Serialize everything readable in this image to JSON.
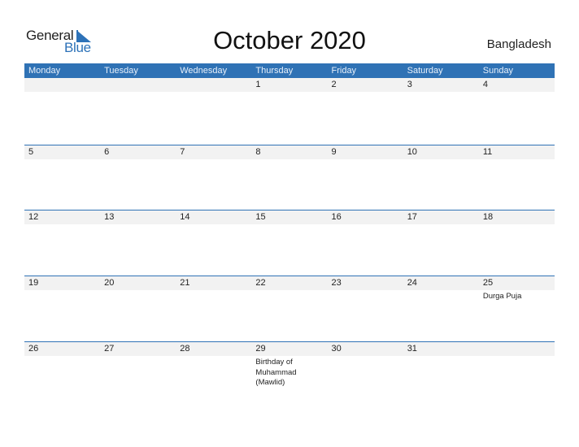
{
  "logo": {
    "word1": "General",
    "word2": "Blue"
  },
  "title": "October 2020",
  "country": "Bangladesh",
  "weekdays": [
    "Monday",
    "Tuesday",
    "Wednesday",
    "Thursday",
    "Friday",
    "Saturday",
    "Sunday"
  ],
  "weeks": [
    [
      {
        "day": ""
      },
      {
        "day": ""
      },
      {
        "day": ""
      },
      {
        "day": "1"
      },
      {
        "day": "2"
      },
      {
        "day": "3"
      },
      {
        "day": "4"
      }
    ],
    [
      {
        "day": "5"
      },
      {
        "day": "6"
      },
      {
        "day": "7"
      },
      {
        "day": "8"
      },
      {
        "day": "9"
      },
      {
        "day": "10"
      },
      {
        "day": "11"
      }
    ],
    [
      {
        "day": "12"
      },
      {
        "day": "13"
      },
      {
        "day": "14"
      },
      {
        "day": "15"
      },
      {
        "day": "16"
      },
      {
        "day": "17"
      },
      {
        "day": "18"
      }
    ],
    [
      {
        "day": "19"
      },
      {
        "day": "20"
      },
      {
        "day": "21"
      },
      {
        "day": "22"
      },
      {
        "day": "23"
      },
      {
        "day": "24"
      },
      {
        "day": "25",
        "event": "Durga Puja"
      }
    ],
    [
      {
        "day": "26"
      },
      {
        "day": "27"
      },
      {
        "day": "28"
      },
      {
        "day": "29",
        "event": "Birthday of Muhammad (Mawlid)"
      },
      {
        "day": "30"
      },
      {
        "day": "31"
      },
      {
        "day": ""
      }
    ]
  ],
  "colors": {
    "accent": "#2f72b5",
    "strip": "#f2f2f2",
    "logo_blue": "#2d72b8"
  }
}
